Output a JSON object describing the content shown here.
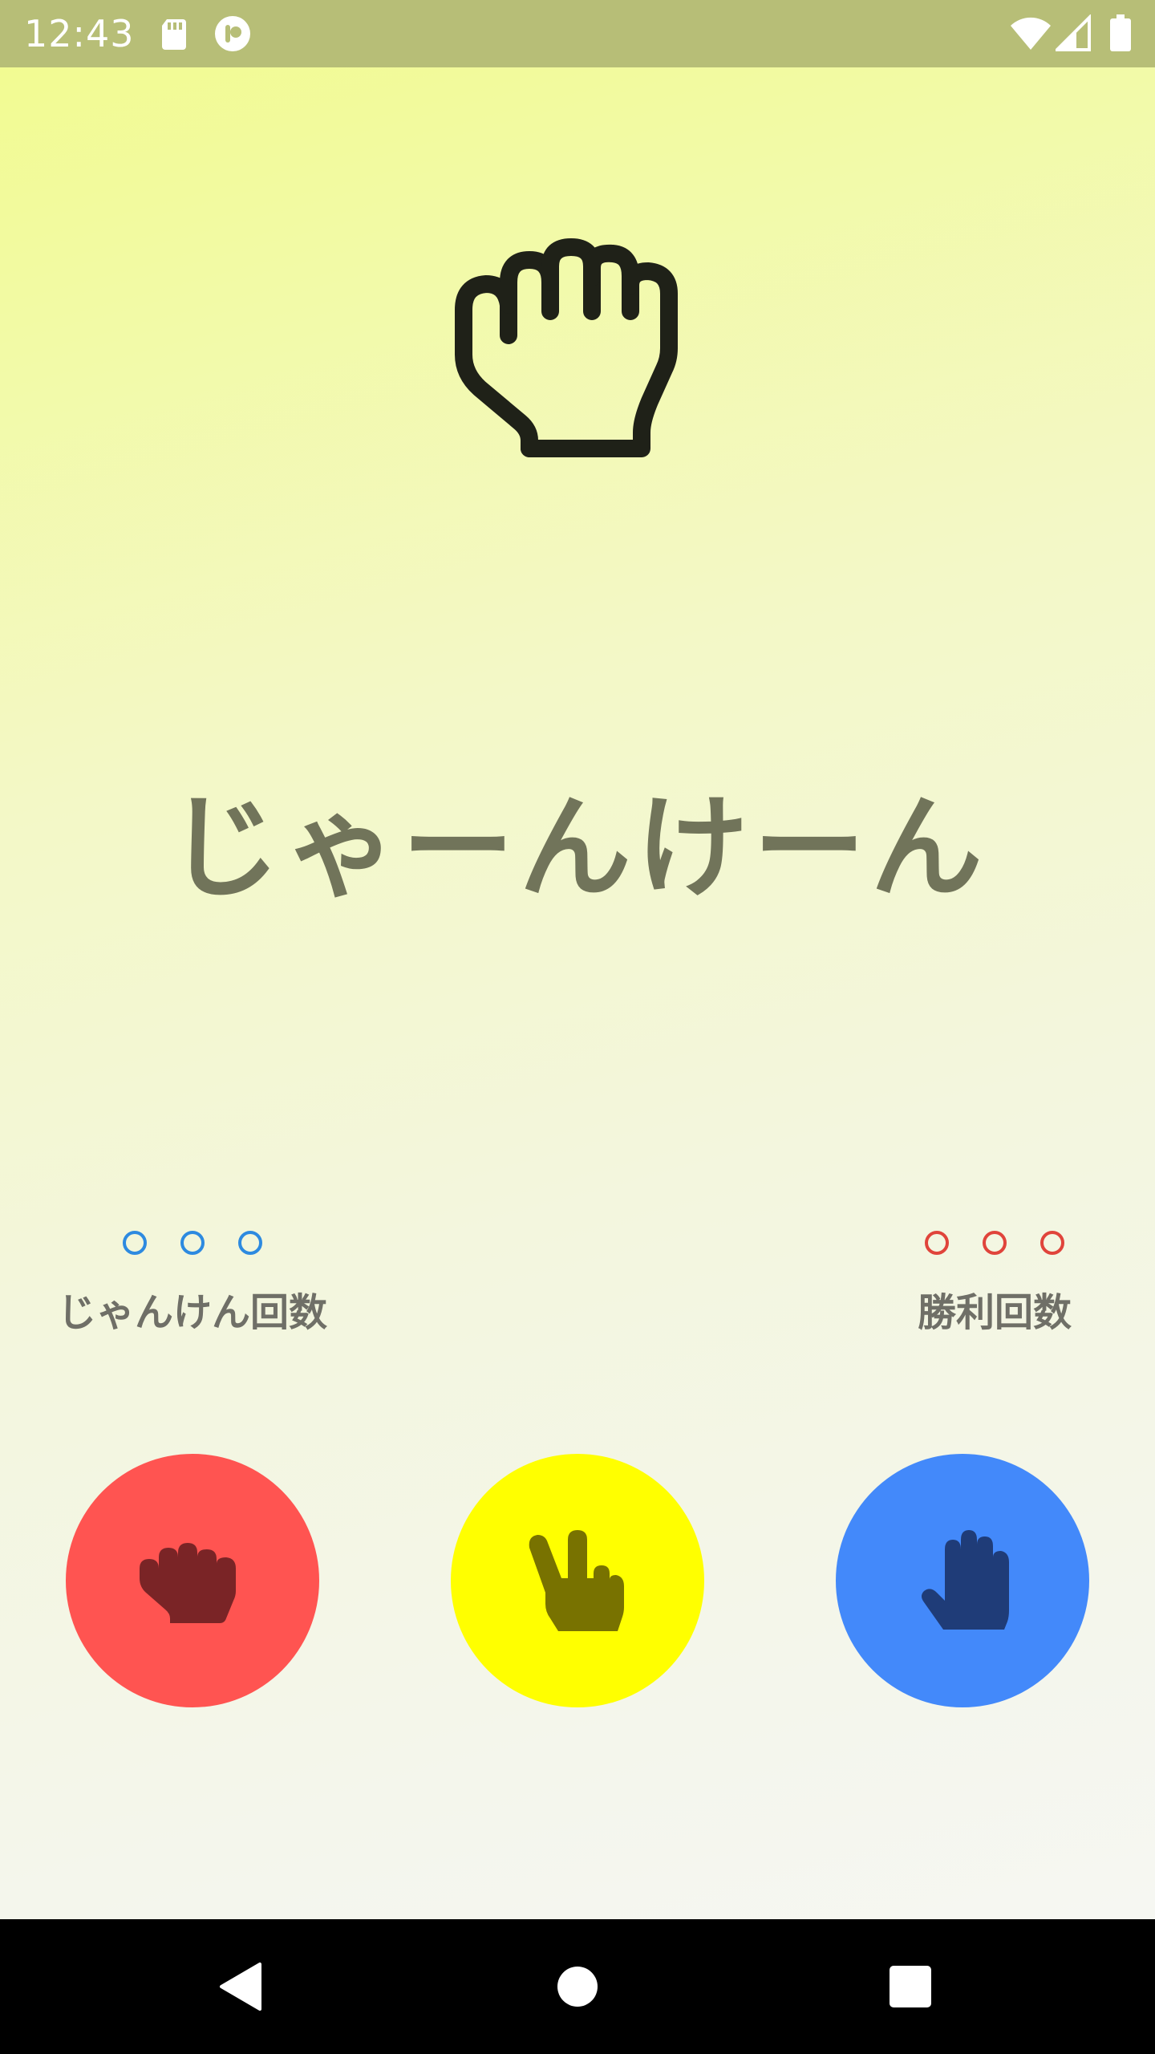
{
  "status_bar": {
    "time": "12:43",
    "left_icons": [
      "sd-card-icon",
      "notification-app-icon"
    ],
    "right_icons": [
      "wifi-icon",
      "cell-signal-icon",
      "battery-icon"
    ],
    "background": "#b7be77"
  },
  "main": {
    "hero_icon": "rock-hand-icon",
    "title": "じゃーんけーん",
    "games_counter": {
      "dots": [
        "○",
        "○",
        "○"
      ],
      "label": "じゃんけん回数",
      "dot_color": "#2d8ae0"
    },
    "wins_counter": {
      "dots": [
        "○",
        "○",
        "○"
      ],
      "label": "勝利回数",
      "dot_color": "#e0443b"
    },
    "buttons": [
      {
        "name": "rock",
        "icon": "rock-hand-icon",
        "color": "#ff5451",
        "icon_color": "#7a2426"
      },
      {
        "name": "scissors",
        "icon": "scissors-hand-icon",
        "color": "#ffff00",
        "icon_color": "#787200"
      },
      {
        "name": "paper",
        "icon": "paper-hand-icon",
        "color": "#4389fa",
        "icon_color": "#1f3c78"
      }
    ]
  },
  "nav_bar": {
    "buttons": [
      "back-icon",
      "home-icon",
      "recents-icon"
    ]
  }
}
